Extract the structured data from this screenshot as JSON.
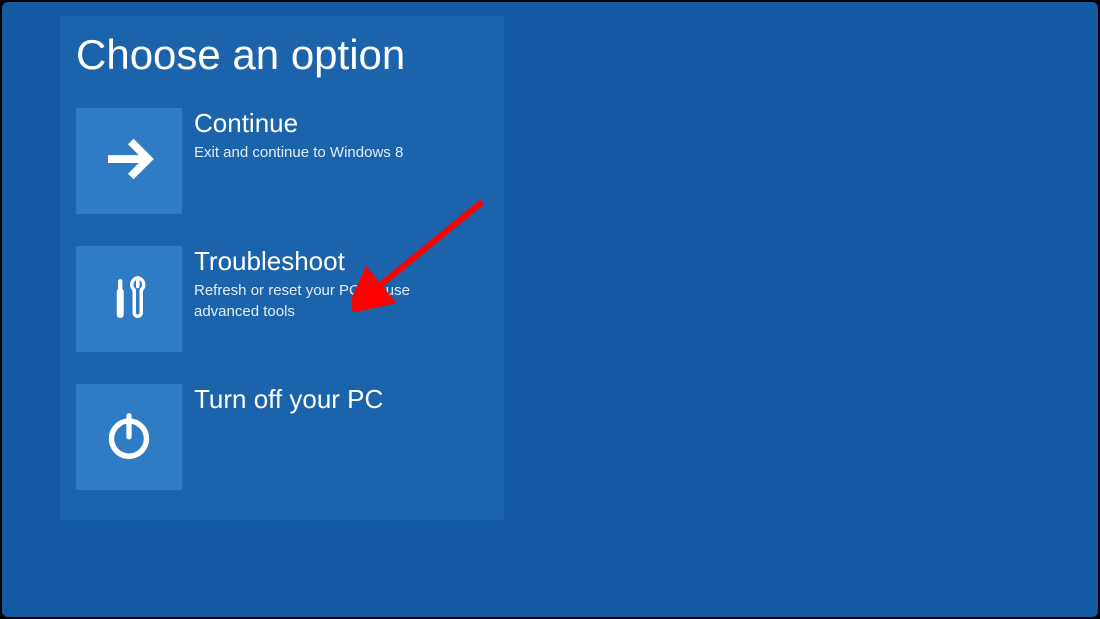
{
  "page_title": "Choose an option",
  "options": [
    {
      "id": "continue",
      "title": "Continue",
      "description": "Exit and continue to Windows 8",
      "icon": "arrow-right-icon"
    },
    {
      "id": "troubleshoot",
      "title": "Troubleshoot",
      "description": "Refresh or reset your PC, or use advanced tools",
      "icon": "tools-icon"
    },
    {
      "id": "turnoff",
      "title": "Turn off your PC",
      "description": "",
      "icon": "power-icon"
    }
  ],
  "annotation": {
    "type": "arrow",
    "target": "troubleshoot",
    "color": "#ff0000"
  },
  "colors": {
    "screen_bg": "#135aa3",
    "panel_bg": "#1b63aa",
    "tile_bg": "#2f7cc4",
    "text": "#ffffff",
    "arrow": "#ff0000"
  }
}
